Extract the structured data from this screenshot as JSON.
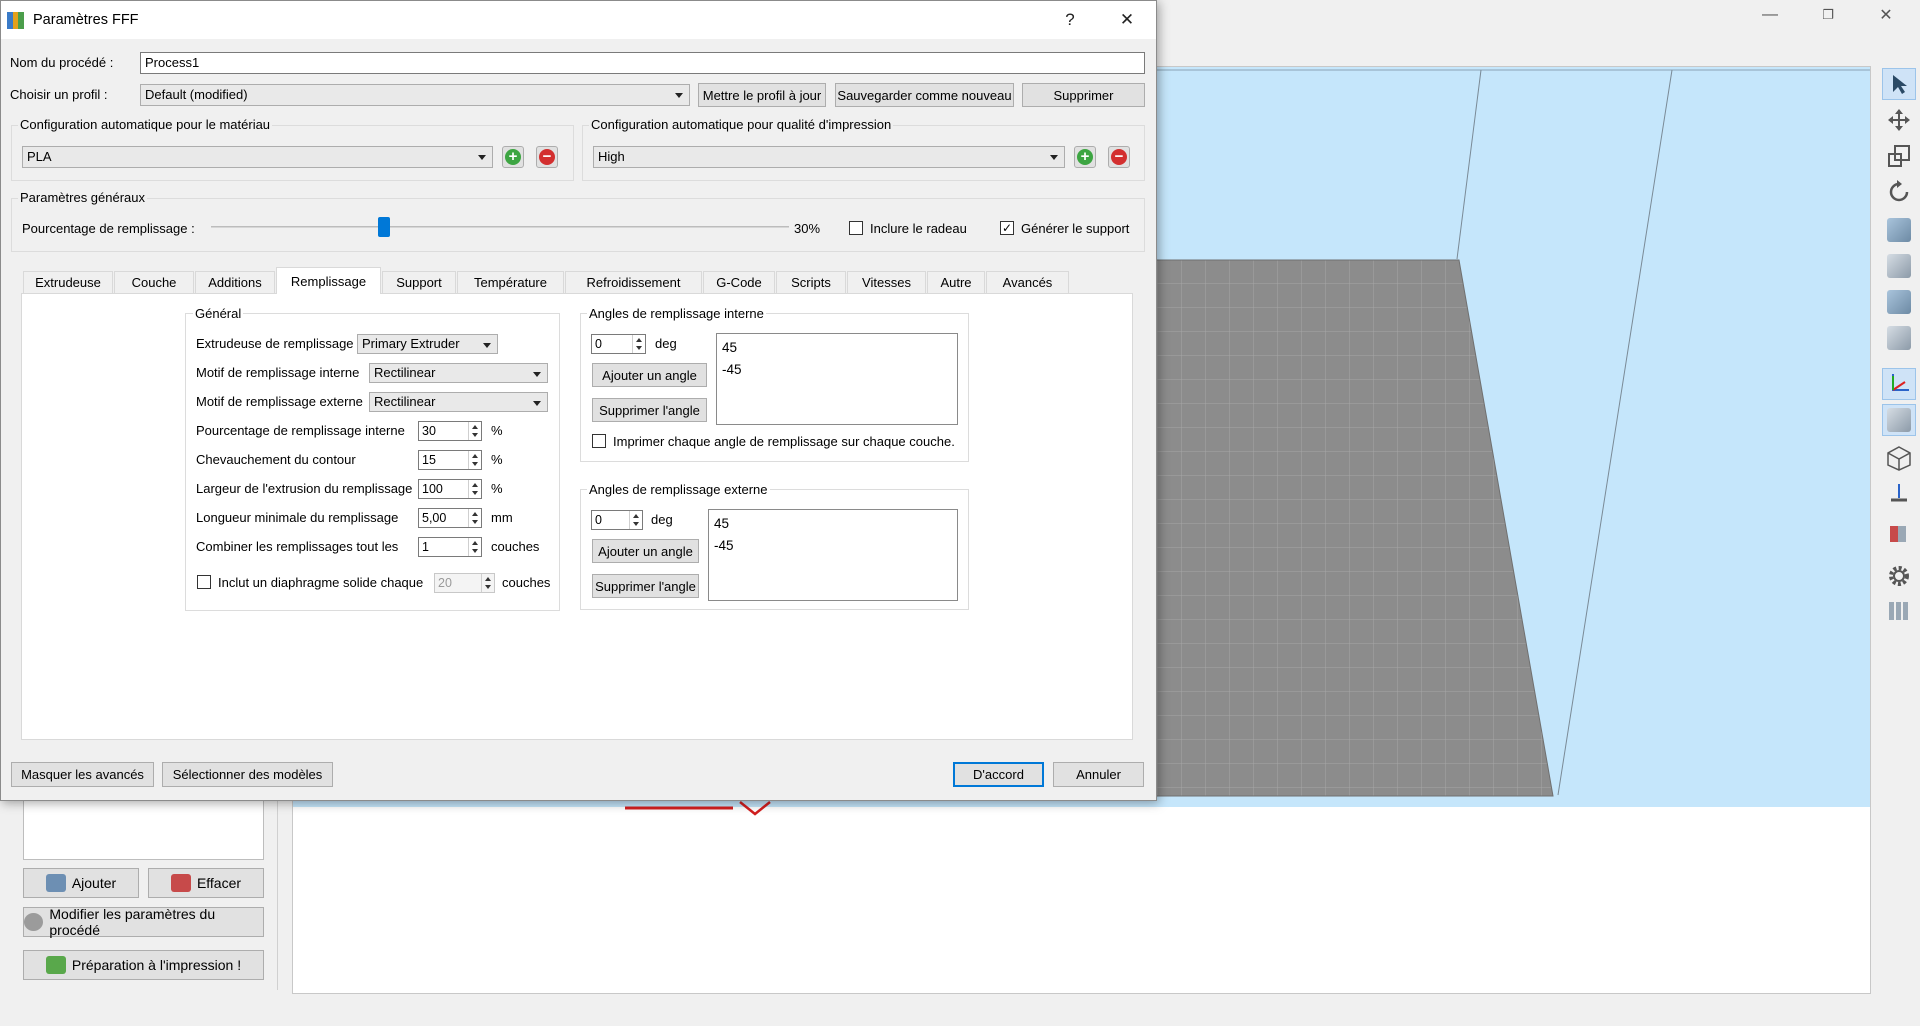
{
  "dialog": {
    "title": "Paramètres FFF",
    "help": "?",
    "close": "✕",
    "process_name_label": "Nom du procédé :",
    "process_name_value": "Process1",
    "profile_label": "Choisir un profil :",
    "profile_value": "Default (modified)",
    "update_profile_btn": "Mettre le profil à jour",
    "save_new_btn": "Sauvegarder comme nouveau",
    "delete_btn": "Supprimer",
    "material_group": "Configuration automatique pour le matériau",
    "material_value": "PLA",
    "quality_group": "Configuration automatique pour qualité d'impression",
    "quality_value": "High",
    "general_group": "Paramètres généraux",
    "infill_label": "Pourcentage de remplissage :",
    "infill_value": "30%",
    "infill_fraction": 0.3,
    "raft_label": "Inclure le radeau",
    "raft_checked": false,
    "support_label": "Générer le support",
    "support_checked": true,
    "tabs": [
      "Extrudeuse",
      "Couche",
      "Additions",
      "Remplissage",
      "Support",
      "Température",
      "Refroidissement",
      "G-Code",
      "Scripts",
      "Vitesses",
      "Autre",
      "Avancés"
    ],
    "active_tab": "Remplissage",
    "hide_advanced_btn": "Masquer les avancés",
    "select_models_btn": "Sélectionner des modèles",
    "ok_btn": "D'accord",
    "cancel_btn": "Annuler"
  },
  "infill_tab": {
    "general_group": "Général",
    "extruder_label": "Extrudeuse de remplissage",
    "extruder_value": "Primary Extruder",
    "internal_pattern_label": "Motif de remplissage interne",
    "internal_pattern_value": "Rectilinear",
    "external_pattern_label": "Motif de remplissage externe",
    "external_pattern_value": "Rectilinear",
    "internal_pct_label": "Pourcentage de remplissage interne",
    "internal_pct_value": "30",
    "internal_pct_unit": "%",
    "overlap_label": "Chevauchement du contour",
    "overlap_value": "15",
    "overlap_unit": "%",
    "width_label": "Largeur de l'extrusion du remplissage",
    "width_value": "100",
    "width_unit": "%",
    "min_length_label": "Longueur minimale du remplissage",
    "min_length_value": "5,00",
    "min_length_unit": "mm",
    "combine_label": "Combiner les remplissages tout les",
    "combine_value": "1",
    "combine_unit": "couches",
    "diaphragm_label": "Inclut un diaphragme solide chaque",
    "diaphragm_value": "20",
    "diaphragm_unit": "couches",
    "diaphragm_checked": false,
    "internal_angles_group": "Angles de remplissage interne",
    "internal_angle_input": "0",
    "internal_angle_unit": "deg",
    "internal_add_btn": "Ajouter un angle",
    "internal_remove_btn": "Supprimer l'angle",
    "internal_angles": [
      "45",
      "-45"
    ],
    "print_each_angle_label": "Imprimer chaque angle de remplissage sur chaque couche.",
    "print_each_angle_checked": false,
    "external_angles_group": "Angles de remplissage externe",
    "external_angle_input": "0",
    "external_angle_unit": "deg",
    "external_add_btn": "Ajouter un angle",
    "external_remove_btn": "Supprimer l'angle",
    "external_angles": [
      "45",
      "-45"
    ]
  },
  "main_app": {
    "minimize": "—",
    "maximize": "❐",
    "close": "✕",
    "add_btn": "Ajouter",
    "clear_btn": "Effacer",
    "edit_process_btn": "Modifier les paramètres du procédé",
    "prepare_btn": "Préparation à l'impression !"
  },
  "colors": {
    "sky": "#c5e6fb",
    "bed": "#8a8a8a",
    "model": "#f7a81b",
    "accent": "#0078d7"
  }
}
